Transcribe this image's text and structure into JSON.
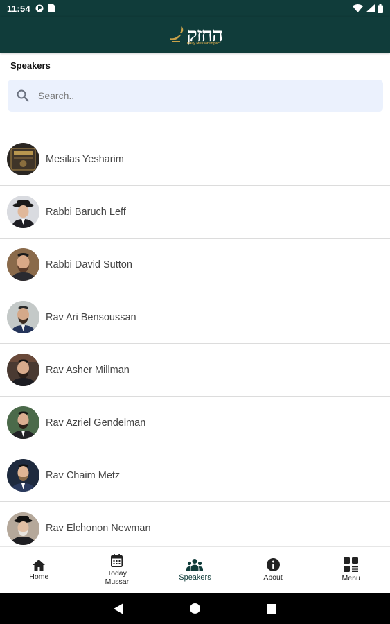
{
  "status_bar": {
    "time": "11:54",
    "icons": [
      "notification-icon",
      "sim-icon",
      "wifi-icon",
      "signal-icon",
      "battery-icon"
    ]
  },
  "header": {
    "logo_text": "החזק",
    "logo_sub": "Daily Mussar Impact",
    "logo_icon": "lamp-icon"
  },
  "page": {
    "title": "Speakers"
  },
  "search": {
    "placeholder": "Search..",
    "value": "",
    "icon": "search-icon"
  },
  "speakers": [
    {
      "name": "Mesilas Yesharim"
    },
    {
      "name": "Rabbi Baruch Leff"
    },
    {
      "name": "Rabbi David Sutton"
    },
    {
      "name": "Rav Ari Bensoussan"
    },
    {
      "name": "Rav Asher Millman"
    },
    {
      "name": "Rav Azriel Gendelman"
    },
    {
      "name": "Rav Chaim Metz"
    },
    {
      "name": "Rav Elchonon Newman"
    }
  ],
  "bottom_nav": [
    {
      "label": "Home",
      "icon": "home-icon",
      "active": false
    },
    {
      "label": "Today\nMussar",
      "icon": "calendar-icon",
      "active": false
    },
    {
      "label": "Speakers",
      "icon": "people-icon",
      "active": true
    },
    {
      "label": "About",
      "icon": "info-icon",
      "active": false
    },
    {
      "label": "Menu",
      "icon": "grid-icon",
      "active": false
    }
  ],
  "colors": {
    "header_bg": "#103c3a",
    "search_bg": "#ebf1fd",
    "logo_accent": "#c9a24a",
    "active_nav": "#103c3a"
  }
}
